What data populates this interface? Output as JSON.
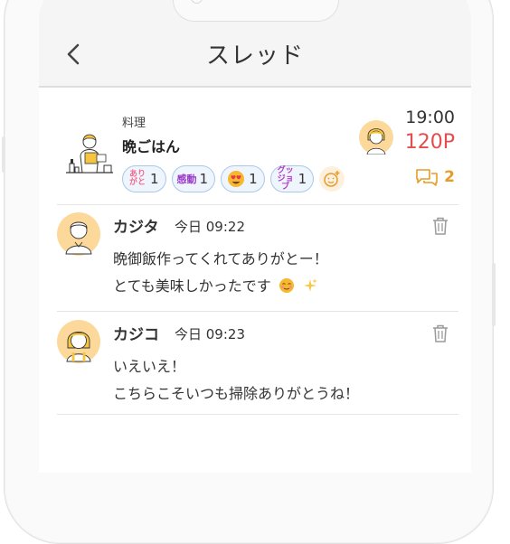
{
  "header": {
    "title": "スレッド"
  },
  "thread": {
    "category": "料理",
    "title": "晩ごはん",
    "time": "19:00",
    "points": "120P",
    "comment_count": "2",
    "reactions": [
      {
        "icon_name": "arigato-icon",
        "icon_text": "あり\nがと",
        "color": "#f06c8f",
        "count": "1"
      },
      {
        "icon_name": "kandou-icon",
        "icon_text": "感動",
        "color": "#9b39c9",
        "count": "1"
      },
      {
        "icon_name": "heart-eyes-emoji-icon",
        "icon_text": "",
        "color": "#f5b82e",
        "count": "1"
      },
      {
        "icon_name": "good-job-icon",
        "icon_text": "グッ\nジョブ",
        "color": "#b23ac8",
        "count": "1"
      }
    ]
  },
  "comments": [
    {
      "name": "カジタ",
      "time": "今日 09:22",
      "line1": "晩御飯作ってくれてありがとー！",
      "line2": "とても美味しかったです"
    },
    {
      "name": "カジコ",
      "time": "今日 09:23",
      "line1": "いえいえ！",
      "line2": "こちらこそいつも掃除ありがとうね！"
    }
  ],
  "colors": {
    "points": "#e34d4d",
    "accent": "#e89b27",
    "pill_border": "#a9c8ea",
    "avatar_bg": "#fcd99a"
  }
}
